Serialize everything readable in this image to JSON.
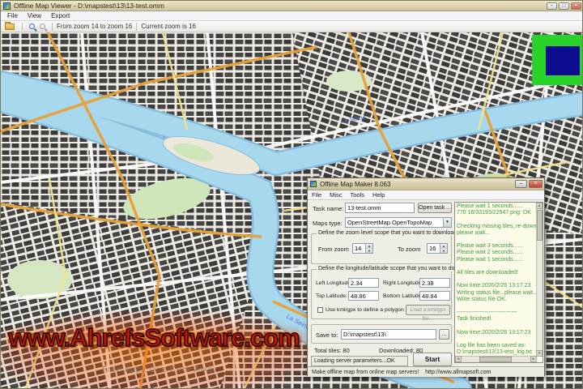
{
  "window": {
    "title": "Offline Map Viewer - D:\\mapstest\\13\\13-test.omm",
    "menus": [
      "File",
      "View",
      "Export"
    ],
    "toolbar": {
      "zoom_range": "From zoom 14 to zoom 16",
      "current_zoom": "Current zoom is 16"
    },
    "controls": {
      "minimize": "–",
      "maximize": "□",
      "close": "×"
    }
  },
  "map": {
    "river_label": "La Seine"
  },
  "overlay_colors": {
    "green": "#2ad32a",
    "navy": "#0c0c8e"
  },
  "dialog": {
    "title": "Offline Map Maker 8.063",
    "menus": [
      "File",
      "Misc",
      "Tools",
      "Help"
    ],
    "task": {
      "label": "Task name:",
      "value": "13-test.omm",
      "open_button": "Open task ..."
    },
    "maps_type": {
      "label": "Maps type:",
      "value": "OpenStreetMap OpenTopoMap"
    },
    "zoom_scope": {
      "title": "Define the zoom level scope that you want to download",
      "from_label": "From zoom",
      "from_value": "14",
      "to_label": "To zoom",
      "to_value": "16"
    },
    "area_scope": {
      "title": "Define the longitude/latitude scope that you want to download",
      "left_label": "Left Longitude:",
      "left_value": "2.34",
      "right_label": "Right Longitude:",
      "right_value": "2.38",
      "top_label": "Top Latitude:",
      "top_value": "48.86",
      "bottom_label": "Bottom Latitude:",
      "bottom_value": "48.84",
      "kml_checkbox": "Use kml/gpx to define a polygon area",
      "load_kml_button": "Load a kml/gpx file..."
    },
    "save": {
      "label": "Save to:",
      "value": "D:\\mapstest\\13\\",
      "browse": "..."
    },
    "totals": {
      "total": "Total tiles: 80",
      "downloaded": "Downloaded: 80"
    },
    "progress_text": "Loading server parameters...OK",
    "start_button": "Start",
    "log_lines": [
      "Please wait 1 seconds......",
      "770 16/33193/22547.png: OK",
      "",
      "Checking missing tiles, re-download them....",
      "please wait...",
      "",
      "Please wait 3 seconds......",
      "Please wait 2 seconds......",
      "Please wait 1 seconds......",
      "",
      "All tiles are downloaded!",
      "",
      "Now time:2020/2/26 13:17:23",
      "Writing status file...please wait...",
      "Write status file OK.",
      "",
      "--------------------------------",
      "Task finished!",
      "",
      "Now time:2020/2/26 13:17:23",
      "",
      "Log file has been saved as:",
      "D:\\mapstest\\13\\13-test_log.txt"
    ],
    "statusbar": {
      "left": "Make offline map from online map servers!",
      "right": "http://www.allmapsoft.com"
    }
  },
  "watermark": {
    "main": "www.AhrefsSoftware.com",
    "sub": "Free Apps One Click Away"
  }
}
